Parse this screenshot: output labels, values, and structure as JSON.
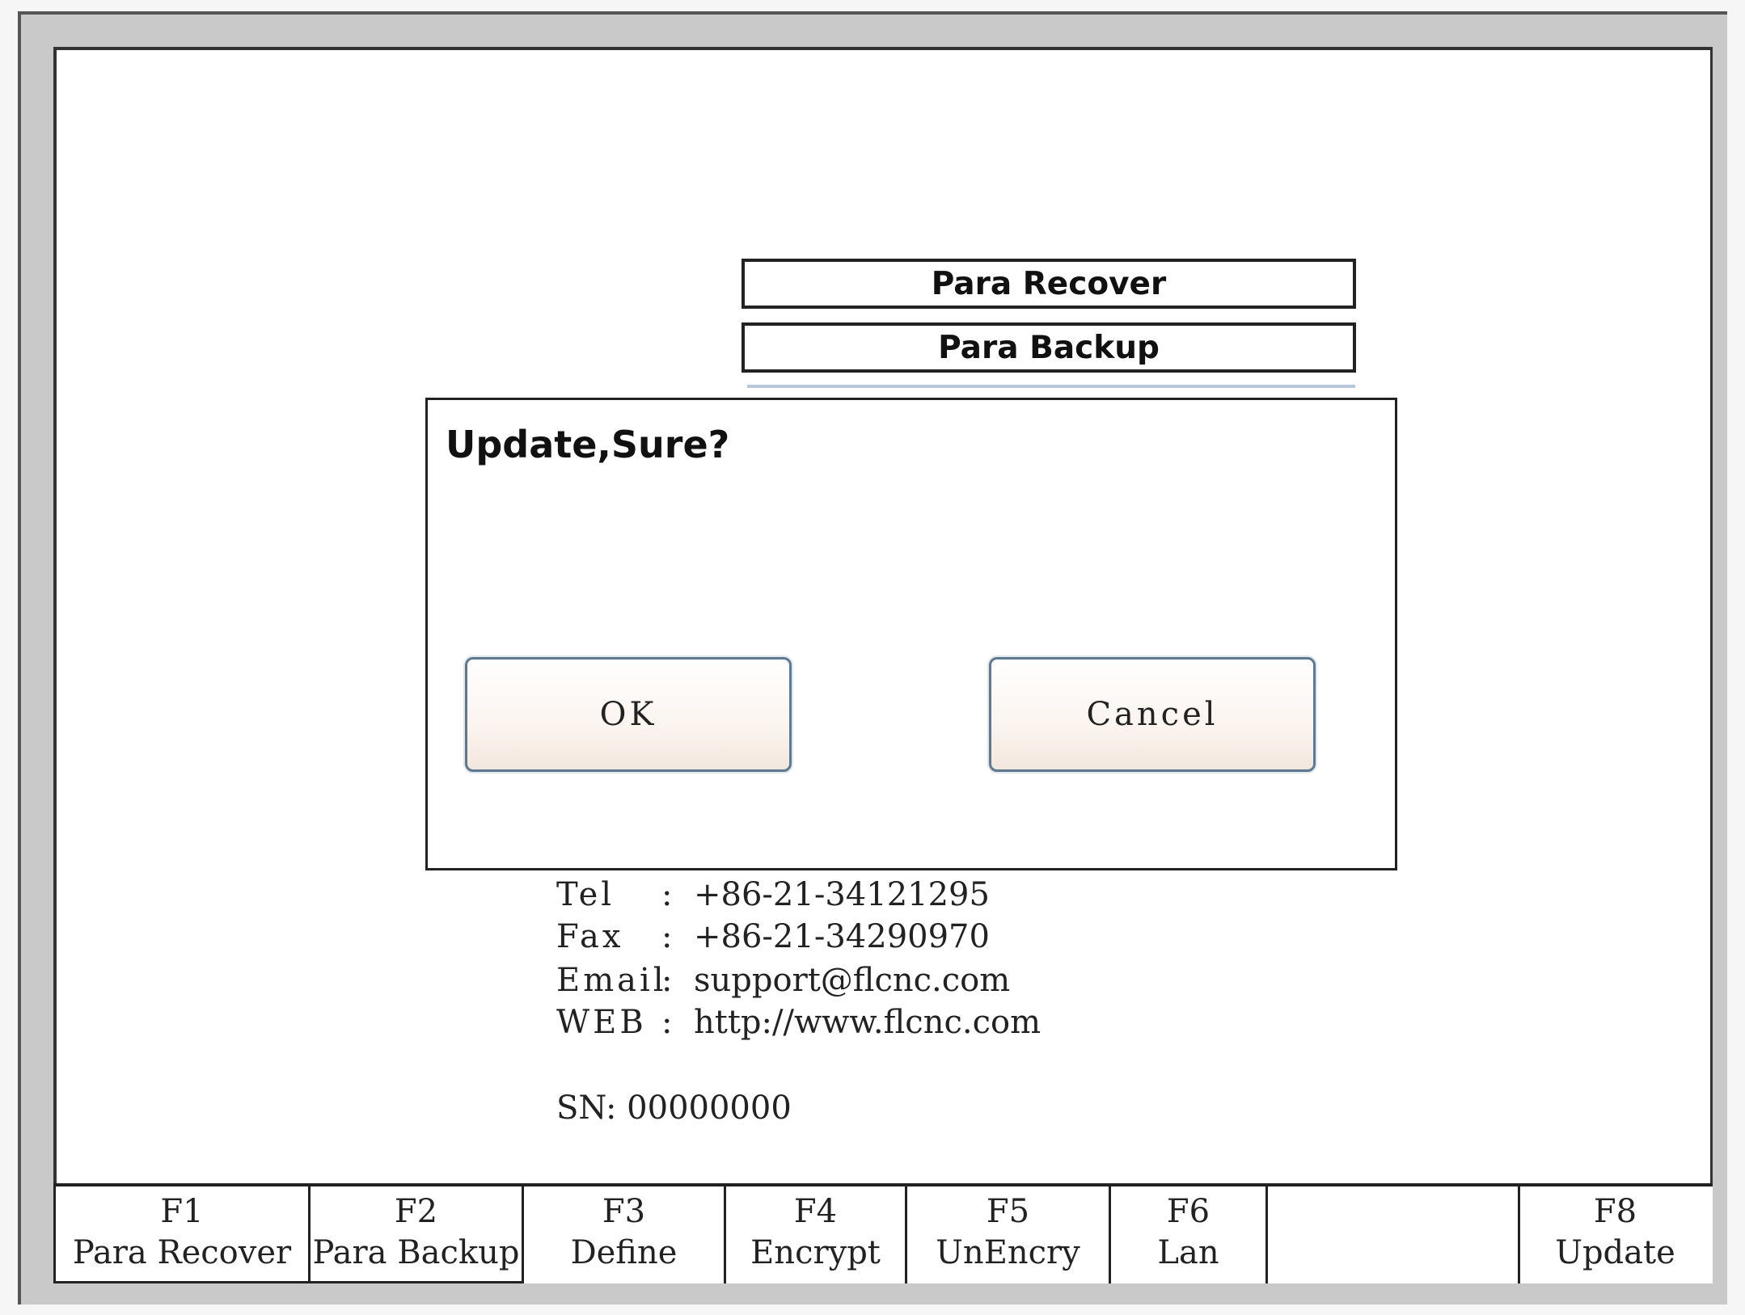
{
  "menu": {
    "items": [
      "Para Recover",
      "Para Backup"
    ]
  },
  "dialog": {
    "message": "Update,Sure?",
    "ok_label": "OK",
    "cancel_label": "Cancel"
  },
  "contact": {
    "tel_label": "Tel",
    "tel_value": "+86-21-34121295",
    "fax_label": "Fax",
    "fax_value": "+86-21-34290970",
    "email_label": "Email",
    "email_value": "support@flcnc.com",
    "web_label": "WEB",
    "web_value": "http://www.flcnc.com",
    "separator": ":",
    "sn_label": "SN:",
    "sn_value": "00000000"
  },
  "function_keys": [
    {
      "key": "F1",
      "label": "Para Recover"
    },
    {
      "key": "F2",
      "label": "Para Backup"
    },
    {
      "key": "F3",
      "label": "Define"
    },
    {
      "key": "F4",
      "label": "Encrypt"
    },
    {
      "key": "F5",
      "label": "UnEncry"
    },
    {
      "key": "F6",
      "label": "Lan"
    },
    {
      "key": "",
      "label": ""
    },
    {
      "key": "F8",
      "label": "Update"
    }
  ]
}
